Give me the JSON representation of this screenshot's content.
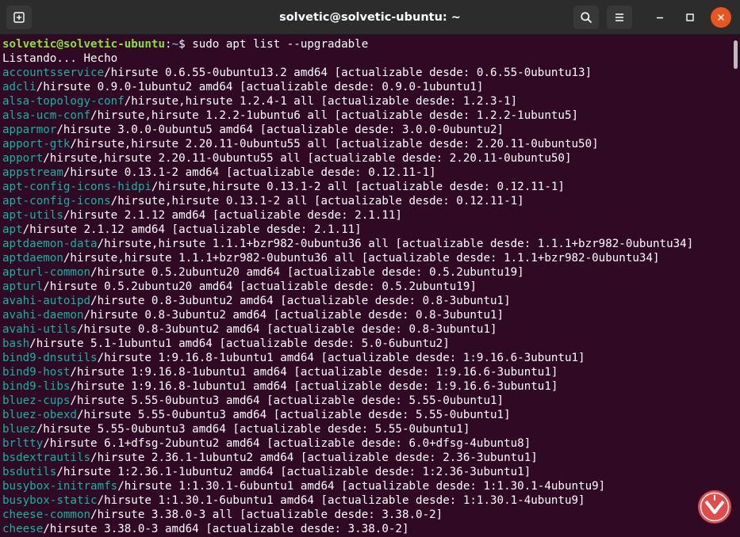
{
  "window": {
    "title": "solvetic@solvetic-ubuntu: ~"
  },
  "icons": {
    "new_tab": "new-tab-icon",
    "search": "search-icon",
    "menu": "hamburger-menu-icon",
    "minimize": "minimize-icon",
    "maximize": "maximize-icon",
    "close": "close-icon",
    "watermark": "solvetic-logo"
  },
  "colors": {
    "background": "#300a24",
    "titlebar": "#2c2c2c",
    "user_prompt": "#8ae234",
    "path_prompt": "#729fcf",
    "package_name": "#11b5a5",
    "close_button": "#e95420"
  },
  "terminal": {
    "prompt_user": "solvetic@solvetic-ubuntu",
    "prompt_sep": ":",
    "prompt_path": "~",
    "prompt_symbol": "$ ",
    "command": "sudo apt list --upgradable",
    "status": "Listando... Hecho",
    "packages": [
      {
        "name": "accountsservice",
        "info": "/hirsute 0.6.55-0ubuntu13.2 amd64 [actualizable desde: 0.6.55-0ubuntu13]"
      },
      {
        "name": "adcli",
        "info": "/hirsute 0.9.0-1ubuntu2 amd64 [actualizable desde: 0.9.0-1ubuntu1]"
      },
      {
        "name": "alsa-topology-conf",
        "info": "/hirsute,hirsute 1.2.4-1 all [actualizable desde: 1.2.3-1]"
      },
      {
        "name": "alsa-ucm-conf",
        "info": "/hirsute,hirsute 1.2.2-1ubuntu6 all [actualizable desde: 1.2.2-1ubuntu5]"
      },
      {
        "name": "apparmor",
        "info": "/hirsute 3.0.0-0ubuntu5 amd64 [actualizable desde: 3.0.0-0ubuntu2]"
      },
      {
        "name": "apport-gtk",
        "info": "/hirsute,hirsute 2.20.11-0ubuntu55 all [actualizable desde: 2.20.11-0ubuntu50]"
      },
      {
        "name": "apport",
        "info": "/hirsute,hirsute 2.20.11-0ubuntu55 all [actualizable desde: 2.20.11-0ubuntu50]"
      },
      {
        "name": "appstream",
        "info": "/hirsute 0.13.1-2 amd64 [actualizable desde: 0.12.11-1]"
      },
      {
        "name": "apt-config-icons-hidpi",
        "info": "/hirsute,hirsute 0.13.1-2 all [actualizable desde: 0.12.11-1]"
      },
      {
        "name": "apt-config-icons",
        "info": "/hirsute,hirsute 0.13.1-2 all [actualizable desde: 0.12.11-1]"
      },
      {
        "name": "apt-utils",
        "info": "/hirsute 2.1.12 amd64 [actualizable desde: 2.1.11]"
      },
      {
        "name": "apt",
        "info": "/hirsute 2.1.12 amd64 [actualizable desde: 2.1.11]"
      },
      {
        "name": "aptdaemon-data",
        "info": "/hirsute,hirsute 1.1.1+bzr982-0ubuntu36 all [actualizable desde: 1.1.1+bzr982-0ubuntu34]"
      },
      {
        "name": "aptdaemon",
        "info": "/hirsute,hirsute 1.1.1+bzr982-0ubuntu36 all [actualizable desde: 1.1.1+bzr982-0ubuntu34]"
      },
      {
        "name": "apturl-common",
        "info": "/hirsute 0.5.2ubuntu20 amd64 [actualizable desde: 0.5.2ubuntu19]"
      },
      {
        "name": "apturl",
        "info": "/hirsute 0.5.2ubuntu20 amd64 [actualizable desde: 0.5.2ubuntu19]"
      },
      {
        "name": "avahi-autoipd",
        "info": "/hirsute 0.8-3ubuntu2 amd64 [actualizable desde: 0.8-3ubuntu1]"
      },
      {
        "name": "avahi-daemon",
        "info": "/hirsute 0.8-3ubuntu2 amd64 [actualizable desde: 0.8-3ubuntu1]"
      },
      {
        "name": "avahi-utils",
        "info": "/hirsute 0.8-3ubuntu2 amd64 [actualizable desde: 0.8-3ubuntu1]"
      },
      {
        "name": "bash",
        "info": "/hirsute 5.1-1ubuntu1 amd64 [actualizable desde: 5.0-6ubuntu2]"
      },
      {
        "name": "bind9-dnsutils",
        "info": "/hirsute 1:9.16.8-1ubuntu1 amd64 [actualizable desde: 1:9.16.6-3ubuntu1]"
      },
      {
        "name": "bind9-host",
        "info": "/hirsute 1:9.16.8-1ubuntu1 amd64 [actualizable desde: 1:9.16.6-3ubuntu1]"
      },
      {
        "name": "bind9-libs",
        "info": "/hirsute 1:9.16.8-1ubuntu1 amd64 [actualizable desde: 1:9.16.6-3ubuntu1]"
      },
      {
        "name": "bluez-cups",
        "info": "/hirsute 5.55-0ubuntu3 amd64 [actualizable desde: 5.55-0ubuntu1]"
      },
      {
        "name": "bluez-obexd",
        "info": "/hirsute 5.55-0ubuntu3 amd64 [actualizable desde: 5.55-0ubuntu1]"
      },
      {
        "name": "bluez",
        "info": "/hirsute 5.55-0ubuntu3 amd64 [actualizable desde: 5.55-0ubuntu1]"
      },
      {
        "name": "brltty",
        "info": "/hirsute 6.1+dfsg-2ubuntu2 amd64 [actualizable desde: 6.0+dfsg-4ubuntu8]"
      },
      {
        "name": "bsdextrautils",
        "info": "/hirsute 2.36.1-1ubuntu2 amd64 [actualizable desde: 2.36-3ubuntu1]"
      },
      {
        "name": "bsdutils",
        "info": "/hirsute 1:2.36.1-1ubuntu2 amd64 [actualizable desde: 1:2.36-3ubuntu1]"
      },
      {
        "name": "busybox-initramfs",
        "info": "/hirsute 1:1.30.1-6ubuntu1 amd64 [actualizable desde: 1:1.30.1-4ubuntu9]"
      },
      {
        "name": "busybox-static",
        "info": "/hirsute 1:1.30.1-6ubuntu1 amd64 [actualizable desde: 1:1.30.1-4ubuntu9]"
      },
      {
        "name": "cheese-common",
        "info": "/hirsute 3.38.0-3 all [actualizable desde: 3.38.0-2]"
      },
      {
        "name": "cheese",
        "info": "/hirsute 3.38.0-3 amd64 [actualizable desde: 3.38.0-2]"
      }
    ]
  }
}
